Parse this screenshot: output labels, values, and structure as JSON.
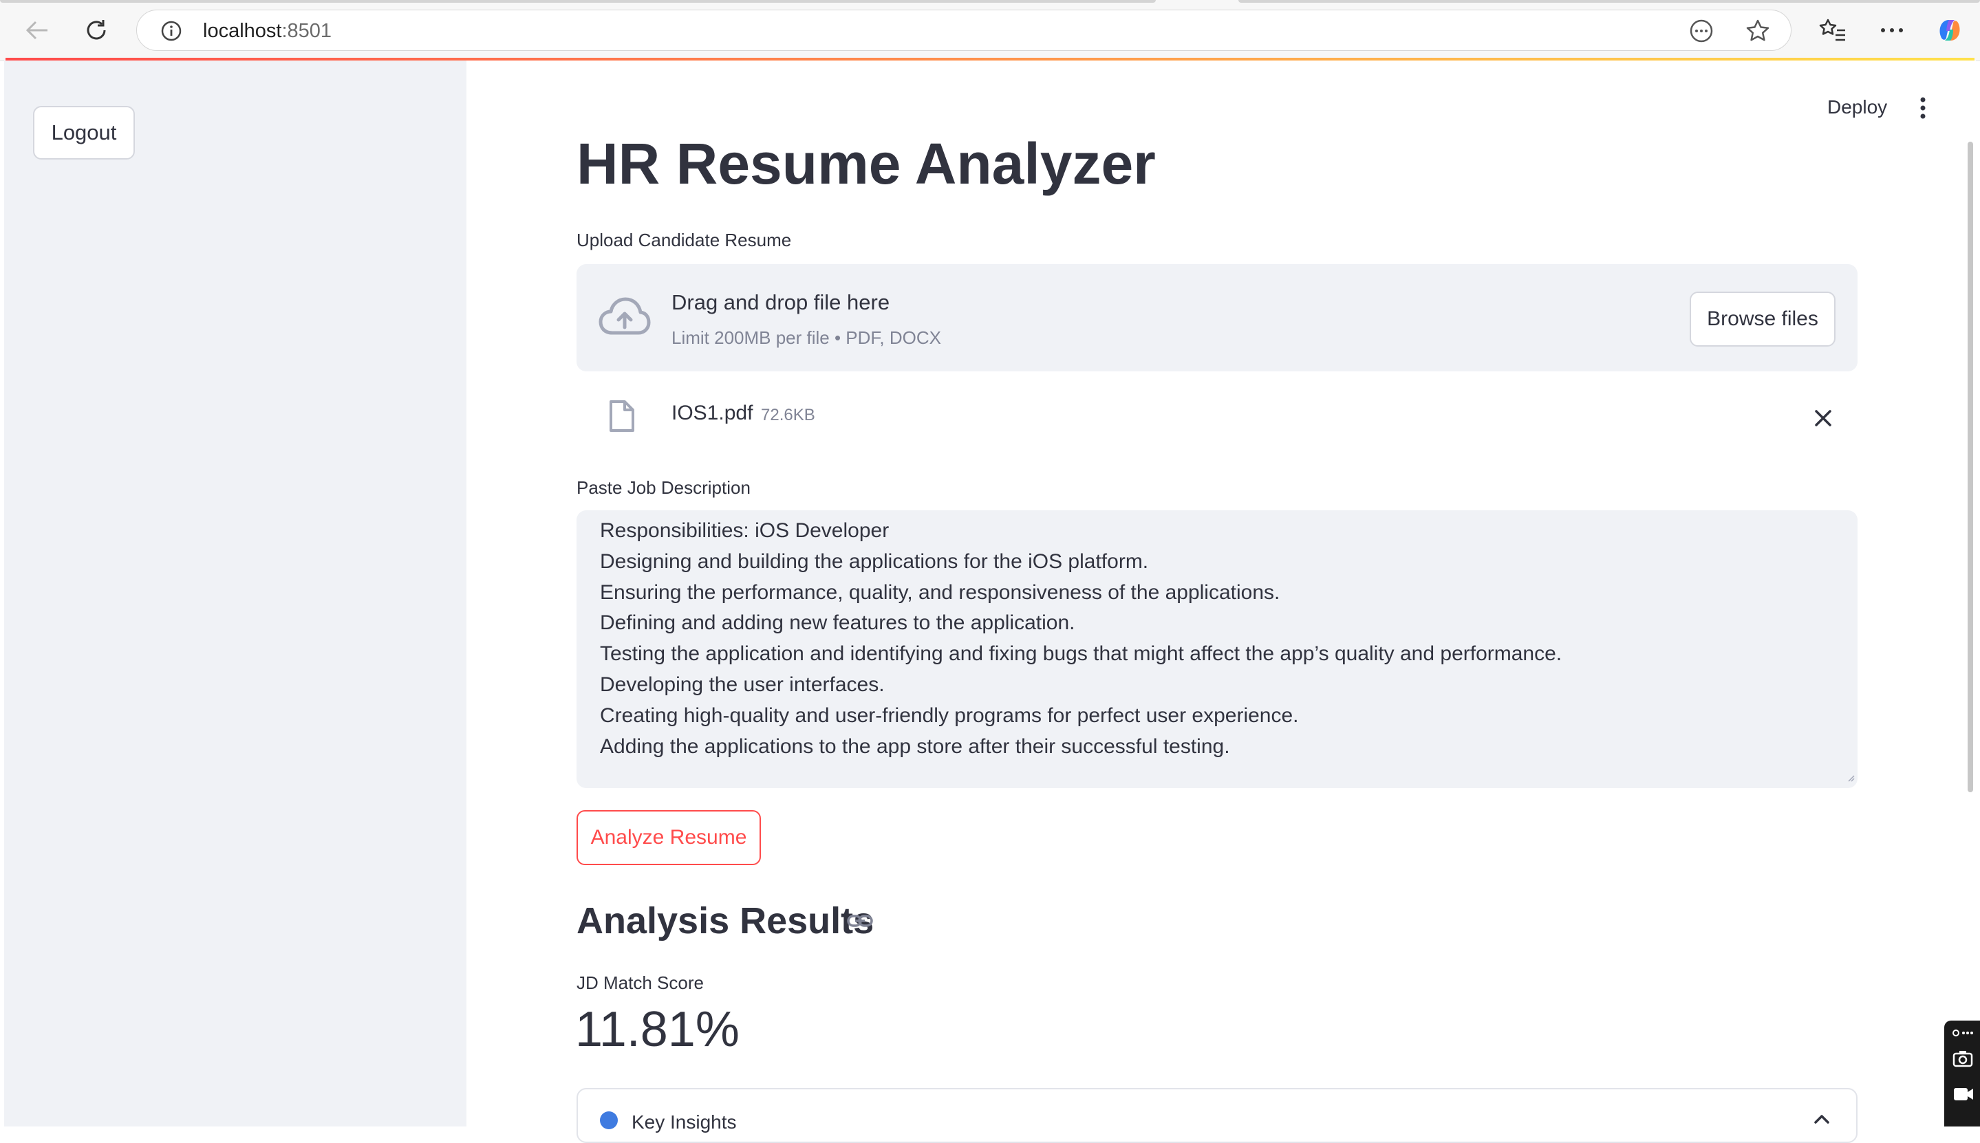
{
  "browser": {
    "url_host": "localhost",
    "url_port": ":8501",
    "icons": [
      "back-arrow-icon",
      "refresh-icon",
      "site-info-icon",
      "reader-icon",
      "favorite-star-icon",
      "favorites-list-icon",
      "more-menu-icon",
      "copilot-icon"
    ]
  },
  "sidebar": {
    "logout_label": "Logout"
  },
  "header": {
    "deploy_label": "Deploy"
  },
  "main": {
    "title": "HR Resume Analyzer",
    "upload": {
      "label": "Upload Candidate Resume",
      "drop_text": "Drag and drop file here",
      "limit_text": "Limit 200MB per file • PDF, DOCX",
      "browse_label": "Browse files",
      "file_name": "IOS1.pdf",
      "file_size": "72.6KB"
    },
    "job_description": {
      "label": "Paste Job Description",
      "lines": [
        "Responsibilities: iOS Developer",
        "Designing and building the applications for the iOS platform.",
        "Ensuring the performance, quality, and responsiveness of the applications.",
        "Defining and adding new features to the application.",
        "Testing the application and identifying and fixing bugs that might affect the app’s quality and performance.",
        "Developing the user interfaces.",
        "Creating high-quality and user-friendly programs for perfect user experience.",
        "Adding the applications to the app store after their successful testing."
      ]
    },
    "analyze_label": "Analyze Resume",
    "results": {
      "title": "Analysis Results",
      "metric_label": "JD Match Score",
      "metric_value": "11.81%",
      "expander_label": "Key Insights"
    }
  },
  "colors": {
    "primary": "#ff4b4b",
    "sidebar_bg": "#f0f2f6",
    "text": "#31333f",
    "muted": "#808495"
  }
}
